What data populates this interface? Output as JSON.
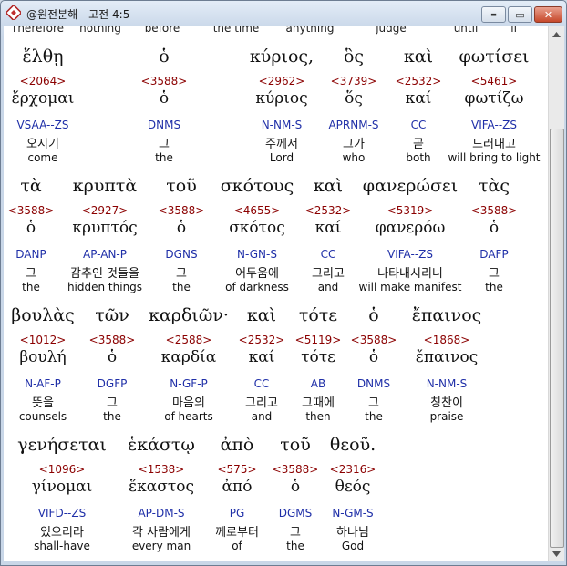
{
  "window": {
    "title": "@원전분해 - 고전 4:5",
    "minimize_glyph": "▬",
    "maximize_glyph": "▭",
    "close_glyph": "✕"
  },
  "cut_row": [
    "Therefore",
    "nothing",
    "before",
    "the time",
    "anything",
    "judge",
    "until",
    "if"
  ],
  "rows": [
    {
      "words": [
        {
          "greek": "ἔλθῃ",
          "strong": "<2064>",
          "lemma": "ἔρχομαι",
          "parse": "VSAA--ZS",
          "korean": "오시기",
          "english": "come"
        },
        {
          "greek": "ὁ",
          "strong": "<3588>",
          "lemma": "ὁ",
          "parse": "DNMS",
          "korean": "그",
          "english": "the"
        },
        {
          "greek": "κύριος,",
          "strong": "<2962>",
          "lemma": "κύριος",
          "parse": "N-NM-S",
          "korean": "주께서",
          "english": "Lord"
        },
        {
          "greek": "ὃς",
          "strong": "<3739>",
          "lemma": "ὅς",
          "parse": "APRNM-S",
          "korean": "그가",
          "english": "who"
        },
        {
          "greek": "καὶ",
          "strong": "<2532>",
          "lemma": "καί",
          "parse": "CC",
          "korean": "곧",
          "english": "both"
        },
        {
          "greek": "φωτίσει",
          "strong": "<5461>",
          "lemma": "φωτίζω",
          "parse": "VIFA--ZS",
          "korean": "드러내고",
          "english": "will bring to light"
        }
      ]
    },
    {
      "words": [
        {
          "greek": "τὰ",
          "strong": "<3588>",
          "lemma": "ὁ",
          "parse": "DANP",
          "korean": "그",
          "english": "the"
        },
        {
          "greek": "κρυπτὰ",
          "strong": "<2927>",
          "lemma": "κρυπτός",
          "parse": "AP-AN-P",
          "korean": "감추인 것들을",
          "english": "hidden things"
        },
        {
          "greek": "τοῦ",
          "strong": "<3588>",
          "lemma": "ὁ",
          "parse": "DGNS",
          "korean": "그",
          "english": "the"
        },
        {
          "greek": "σκότους",
          "strong": "<4655>",
          "lemma": "σκότος",
          "parse": "N-GN-S",
          "korean": "어두움에",
          "english": "of darkness"
        },
        {
          "greek": "καὶ",
          "strong": "<2532>",
          "lemma": "καί",
          "parse": "CC",
          "korean": "그리고",
          "english": "and"
        },
        {
          "greek": "φανερώσει",
          "strong": "<5319>",
          "lemma": "φανερόω",
          "parse": "VIFA--ZS",
          "korean": "나타내시리니",
          "english": "will make manifest"
        },
        {
          "greek": "τὰς",
          "strong": "<3588>",
          "lemma": "ὁ",
          "parse": "DAFP",
          "korean": "그",
          "english": "the"
        }
      ]
    },
    {
      "words": [
        {
          "greek": "βουλὰς",
          "strong": "<1012>",
          "lemma": "βουλή",
          "parse": "N-AF-P",
          "korean": "뜻을",
          "english": "counsels"
        },
        {
          "greek": "τῶν",
          "strong": "<3588>",
          "lemma": "ὁ",
          "parse": "DGFP",
          "korean": "그",
          "english": "the"
        },
        {
          "greek": "καρδιῶν·",
          "strong": "<2588>",
          "lemma": "καρδία",
          "parse": "N-GF-P",
          "korean": "마음의",
          "english": "of-hearts"
        },
        {
          "greek": "καὶ",
          "strong": "<2532>",
          "lemma": "καί",
          "parse": "CC",
          "korean": "그리고",
          "english": "and"
        },
        {
          "greek": "τότε",
          "strong": "<5119>",
          "lemma": "τότε",
          "parse": "AB",
          "korean": "그때에",
          "english": "then"
        },
        {
          "greek": "ὁ",
          "strong": "<3588>",
          "lemma": "ὁ",
          "parse": "DNMS",
          "korean": "그",
          "english": "the"
        },
        {
          "greek": "ἔπαινος",
          "strong": "<1868>",
          "lemma": "ἔπαινος",
          "parse": "N-NM-S",
          "korean": "칭찬이",
          "english": "praise"
        }
      ]
    },
    {
      "words": [
        {
          "greek": "γενήσεται",
          "strong": "<1096>",
          "lemma": "γίνομαι",
          "parse": "VIFD--ZS",
          "korean": "있으리라",
          "english": "shall-have"
        },
        {
          "greek": "ἑκάστῳ",
          "strong": "<1538>",
          "lemma": "ἕκαστος",
          "parse": "AP-DM-S",
          "korean": "각 사람에게",
          "english": "every man"
        },
        {
          "greek": "ἀπὸ",
          "strong": "<575>",
          "lemma": "ἀπό",
          "parse": "PG",
          "korean": "께로부터",
          "english": "of"
        },
        {
          "greek": "τοῦ",
          "strong": "<3588>",
          "lemma": "ὁ",
          "parse": "DGMS",
          "korean": "그",
          "english": "the"
        },
        {
          "greek": "θεοῦ.",
          "strong": "<2316>",
          "lemma": "θεός",
          "parse": "N-GM-S",
          "korean": "하나님",
          "english": "God"
        }
      ]
    }
  ]
}
